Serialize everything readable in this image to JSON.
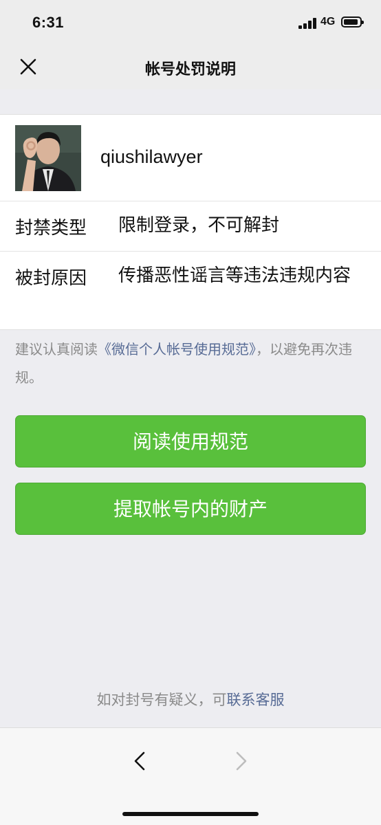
{
  "status_bar": {
    "time": "6:31",
    "network": "4G"
  },
  "nav": {
    "title": "帐号处罚说明"
  },
  "account": {
    "username": "qiushilawyer"
  },
  "rows": [
    {
      "label": "封禁类型",
      "value": "限制登录，不可解封"
    },
    {
      "label": "被封原因",
      "value": "传播恶性谣言等违法违规内容"
    }
  ],
  "advice": {
    "prefix": "建议认真阅读",
    "link": "《微信个人帐号使用规范》",
    "suffix": "，以避免再次违规。"
  },
  "buttons": {
    "read_rules": "阅读使用规范",
    "extract_assets": "提取帐号内的财产"
  },
  "footer": {
    "prefix": "如对封号有疑义，可",
    "link": "联系客服"
  },
  "colors": {
    "accent_green": "#59c03c",
    "link_blue": "#576b95",
    "muted_text": "#8a8a8a"
  }
}
